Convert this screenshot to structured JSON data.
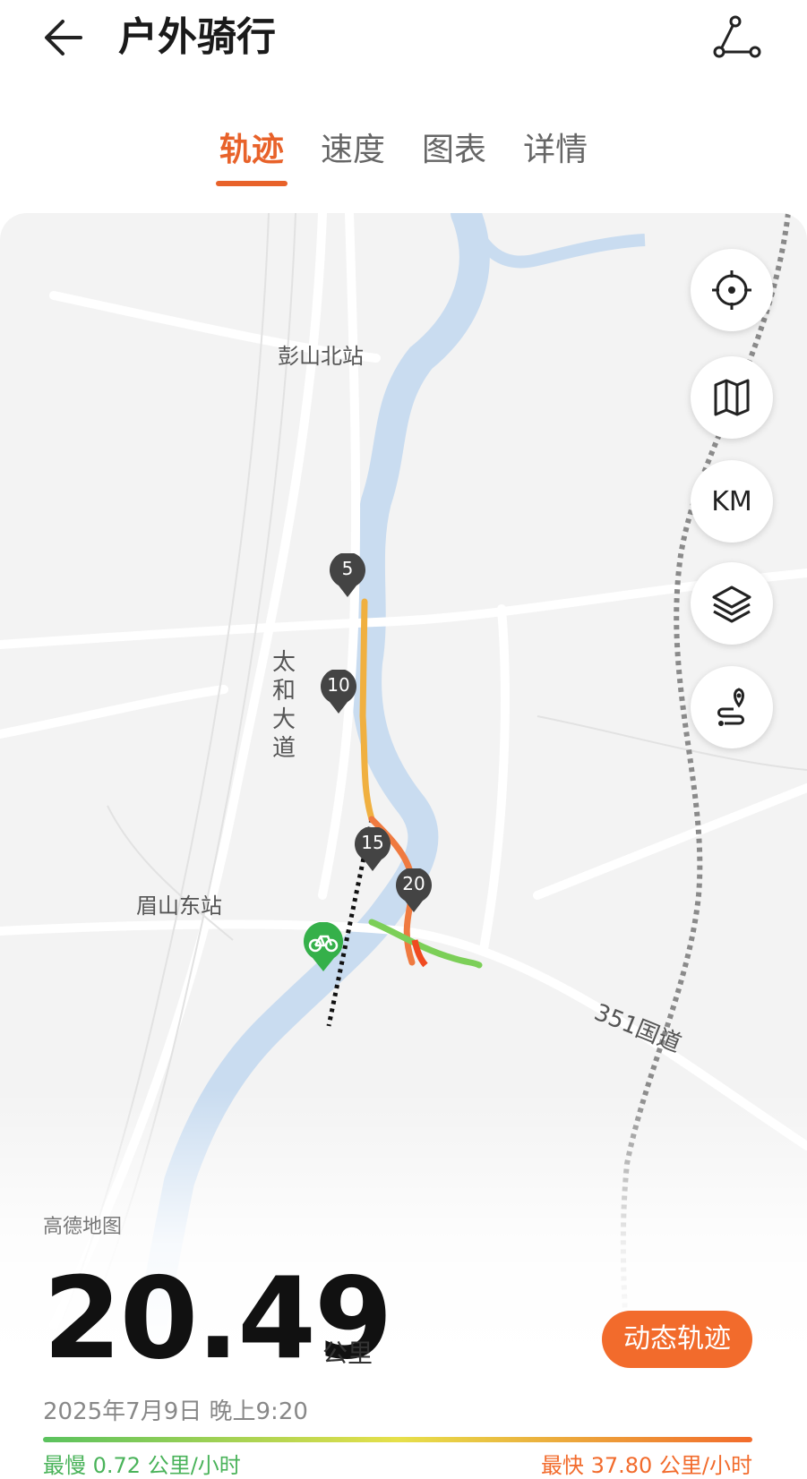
{
  "header": {
    "title": "户外骑行",
    "back_icon": "back-arrow-icon",
    "route_icon": "route-share-icon"
  },
  "tabs": [
    {
      "label": "轨迹",
      "active": true
    },
    {
      "label": "速度",
      "active": false
    },
    {
      "label": "图表",
      "active": false
    },
    {
      "label": "详情",
      "active": false
    }
  ],
  "map": {
    "labels": {
      "station_north": "彭山北站",
      "station_east": "眉山东站",
      "avenue": "太和大道",
      "highway": "351国道",
      "provider": "高德地图"
    },
    "controls": {
      "locate_icon": "locate-icon",
      "map_icon": "map-icon",
      "km_label": "KM",
      "layers_icon": "layers-icon",
      "route_pin_icon": "route-pin-icon"
    },
    "markers": [
      "5",
      "10",
      "15",
      "20"
    ],
    "start_icon": "bicycle-icon",
    "colors": {
      "accent": "#e8622a",
      "river": "#c9dcf0",
      "slow": "#5ac25e",
      "fast": "#f26b2c"
    }
  },
  "summary": {
    "distance": "20.49",
    "unit": "公里",
    "datetime": "2025年7月9日 晚上9:20",
    "dynamic_button": "动态轨迹",
    "slowest": "最慢 0.72 公里/小时",
    "fastest": "最快 37.80 公里/小时"
  }
}
